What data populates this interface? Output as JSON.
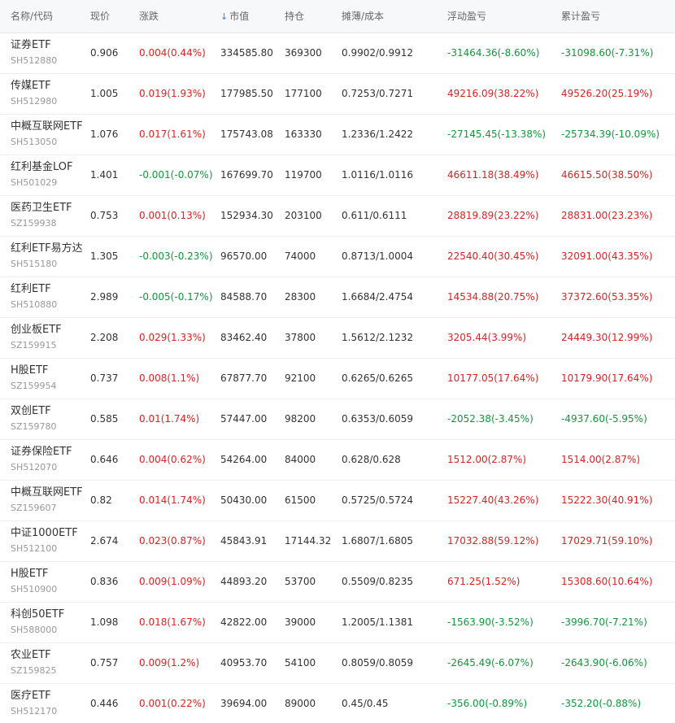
{
  "headers": {
    "name": "名称/代码",
    "price": "现价",
    "change": "涨跌",
    "market_value": "市值",
    "holdings": "持仓",
    "cost": "摊薄/成本",
    "floating_pnl": "浮动盈亏",
    "cumulative_pnl": "累计盈亏"
  },
  "sort_icon": "sort-down-arrow-icon",
  "colors": {
    "up": "#e02020",
    "down": "#0e9a3a",
    "header_bg": "#f7f8fa"
  },
  "rows": [
    {
      "name": "证券ETF",
      "code": "SH512880",
      "price": "0.906",
      "change": "0.004(0.44%)",
      "change_dir": "up",
      "market_value": "334585.80",
      "holdings": "369300",
      "cost": "0.9902/0.9912",
      "floating_pnl": "-31464.36(-8.60%)",
      "floating_dir": "down",
      "cumulative_pnl": "-31098.60(-7.31%)",
      "cumulative_dir": "down"
    },
    {
      "name": "传媒ETF",
      "code": "SH512980",
      "price": "1.005",
      "change": "0.019(1.93%)",
      "change_dir": "up",
      "market_value": "177985.50",
      "holdings": "177100",
      "cost": "0.7253/0.7271",
      "floating_pnl": "49216.09(38.22%)",
      "floating_dir": "up",
      "cumulative_pnl": "49526.20(25.19%)",
      "cumulative_dir": "up"
    },
    {
      "name": "中概互联网ETF",
      "code": "SH513050",
      "price": "1.076",
      "change": "0.017(1.61%)",
      "change_dir": "up",
      "market_value": "175743.08",
      "holdings": "163330",
      "cost": "1.2336/1.2422",
      "floating_pnl": "-27145.45(-13.38%)",
      "floating_dir": "down",
      "cumulative_pnl": "-25734.39(-10.09%)",
      "cumulative_dir": "down"
    },
    {
      "name": "红利基金LOF",
      "code": "SH501029",
      "price": "1.401",
      "change": "-0.001(-0.07%)",
      "change_dir": "down",
      "market_value": "167699.70",
      "holdings": "119700",
      "cost": "1.0116/1.0116",
      "floating_pnl": "46611.18(38.49%)",
      "floating_dir": "up",
      "cumulative_pnl": "46615.50(38.50%)",
      "cumulative_dir": "up"
    },
    {
      "name": "医药卫生ETF",
      "code": "SZ159938",
      "price": "0.753",
      "change": "0.001(0.13%)",
      "change_dir": "up",
      "market_value": "152934.30",
      "holdings": "203100",
      "cost": "0.611/0.6111",
      "floating_pnl": "28819.89(23.22%)",
      "floating_dir": "up",
      "cumulative_pnl": "28831.00(23.23%)",
      "cumulative_dir": "up"
    },
    {
      "name": "红利ETF易方达",
      "code": "SH515180",
      "price": "1.305",
      "change": "-0.003(-0.23%)",
      "change_dir": "down",
      "market_value": "96570.00",
      "holdings": "74000",
      "cost": "0.8713/1.0004",
      "floating_pnl": "22540.40(30.45%)",
      "floating_dir": "up",
      "cumulative_pnl": "32091.00(43.35%)",
      "cumulative_dir": "up"
    },
    {
      "name": "红利ETF",
      "code": "SH510880",
      "price": "2.989",
      "change": "-0.005(-0.17%)",
      "change_dir": "down",
      "market_value": "84588.70",
      "holdings": "28300",
      "cost": "1.6684/2.4754",
      "floating_pnl": "14534.88(20.75%)",
      "floating_dir": "up",
      "cumulative_pnl": "37372.60(53.35%)",
      "cumulative_dir": "up"
    },
    {
      "name": "创业板ETF",
      "code": "SZ159915",
      "price": "2.208",
      "change": "0.029(1.33%)",
      "change_dir": "up",
      "market_value": "83462.40",
      "holdings": "37800",
      "cost": "1.5612/2.1232",
      "floating_pnl": "3205.44(3.99%)",
      "floating_dir": "up",
      "cumulative_pnl": "24449.30(12.99%)",
      "cumulative_dir": "up"
    },
    {
      "name": "H股ETF",
      "code": "SZ159954",
      "price": "0.737",
      "change": "0.008(1.1%)",
      "change_dir": "up",
      "market_value": "67877.70",
      "holdings": "92100",
      "cost": "0.6265/0.6265",
      "floating_pnl": "10177.05(17.64%)",
      "floating_dir": "up",
      "cumulative_pnl": "10179.90(17.64%)",
      "cumulative_dir": "up"
    },
    {
      "name": "双创ETF",
      "code": "SZ159780",
      "price": "0.585",
      "change": "0.01(1.74%)",
      "change_dir": "up",
      "market_value": "57447.00",
      "holdings": "98200",
      "cost": "0.6353/0.6059",
      "floating_pnl": "-2052.38(-3.45%)",
      "floating_dir": "down",
      "cumulative_pnl": "-4937.60(-5.95%)",
      "cumulative_dir": "down"
    },
    {
      "name": "证券保险ETF",
      "code": "SH512070",
      "price": "0.646",
      "change": "0.004(0.62%)",
      "change_dir": "up",
      "market_value": "54264.00",
      "holdings": "84000",
      "cost": "0.628/0.628",
      "floating_pnl": "1512.00(2.87%)",
      "floating_dir": "up",
      "cumulative_pnl": "1514.00(2.87%)",
      "cumulative_dir": "up"
    },
    {
      "name": "中概互联网ETF",
      "code": "SZ159607",
      "price": "0.82",
      "change": "0.014(1.74%)",
      "change_dir": "up",
      "market_value": "50430.00",
      "holdings": "61500",
      "cost": "0.5725/0.5724",
      "floating_pnl": "15227.40(43.26%)",
      "floating_dir": "up",
      "cumulative_pnl": "15222.30(40.91%)",
      "cumulative_dir": "up"
    },
    {
      "name": "中证1000ETF",
      "code": "SH512100",
      "price": "2.674",
      "change": "0.023(0.87%)",
      "change_dir": "up",
      "market_value": "45843.91",
      "holdings": "17144.32",
      "cost": "1.6807/1.6805",
      "floating_pnl": "17032.88(59.12%)",
      "floating_dir": "up",
      "cumulative_pnl": "17029.71(59.10%)",
      "cumulative_dir": "up"
    },
    {
      "name": "H股ETF",
      "code": "SH510900",
      "price": "0.836",
      "change": "0.009(1.09%)",
      "change_dir": "up",
      "market_value": "44893.20",
      "holdings": "53700",
      "cost": "0.5509/0.8235",
      "floating_pnl": "671.25(1.52%)",
      "floating_dir": "up",
      "cumulative_pnl": "15308.60(10.64%)",
      "cumulative_dir": "up"
    },
    {
      "name": "科创50ETF",
      "code": "SH588000",
      "price": "1.098",
      "change": "0.018(1.67%)",
      "change_dir": "up",
      "market_value": "42822.00",
      "holdings": "39000",
      "cost": "1.2005/1.1381",
      "floating_pnl": "-1563.90(-3.52%)",
      "floating_dir": "down",
      "cumulative_pnl": "-3996.70(-7.21%)",
      "cumulative_dir": "down"
    },
    {
      "name": "农业ETF",
      "code": "SZ159825",
      "price": "0.757",
      "change": "0.009(1.2%)",
      "change_dir": "up",
      "market_value": "40953.70",
      "holdings": "54100",
      "cost": "0.8059/0.8059",
      "floating_pnl": "-2645.49(-6.07%)",
      "floating_dir": "down",
      "cumulative_pnl": "-2643.90(-6.06%)",
      "cumulative_dir": "down"
    },
    {
      "name": "医疗ETF",
      "code": "SH512170",
      "price": "0.446",
      "change": "0.001(0.22%)",
      "change_dir": "up",
      "market_value": "39694.00",
      "holdings": "89000",
      "cost": "0.45/0.45",
      "floating_pnl": "-356.00(-0.89%)",
      "floating_dir": "down",
      "cumulative_pnl": "-352.20(-0.88%)",
      "cumulative_dir": "down"
    }
  ]
}
